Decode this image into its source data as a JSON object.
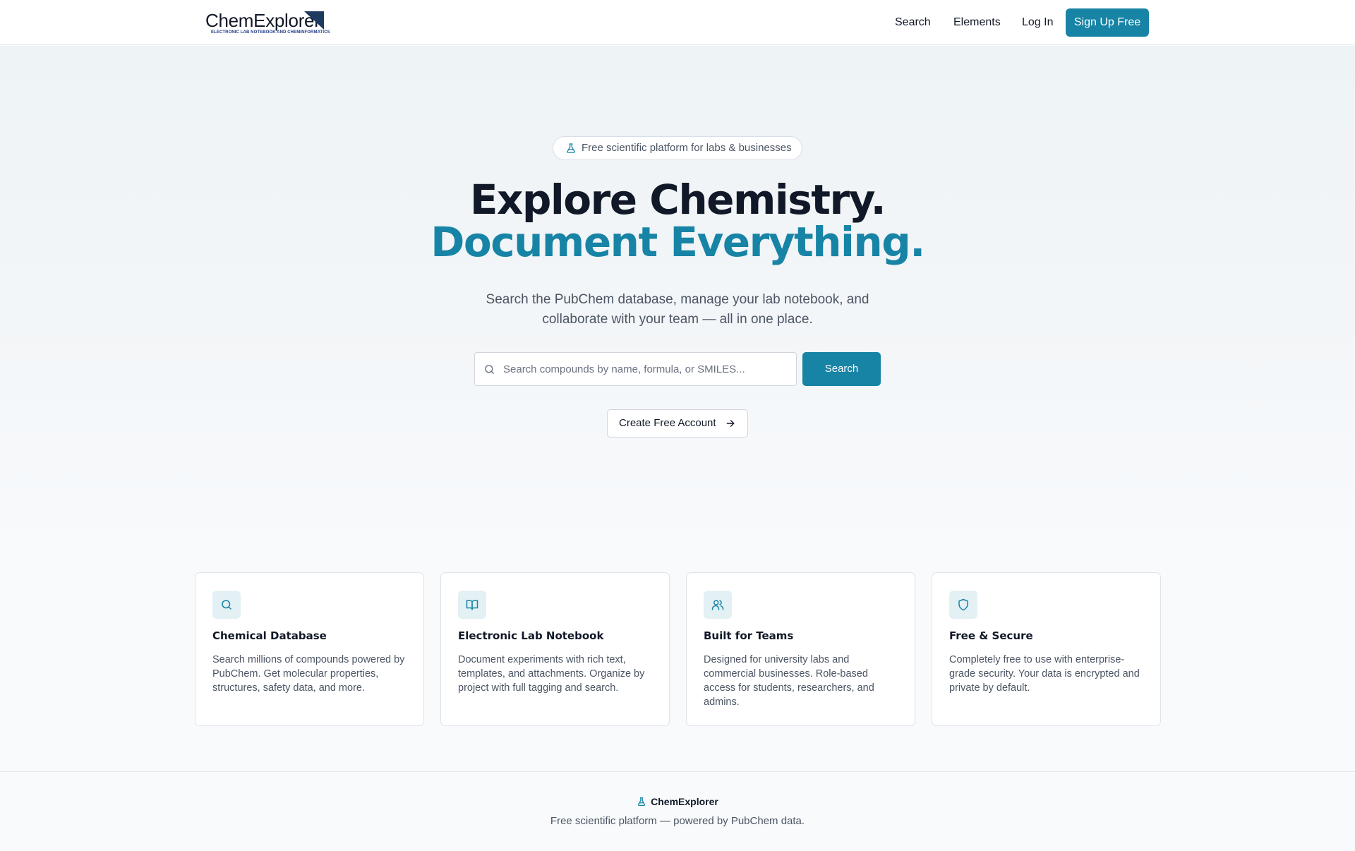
{
  "brand": {
    "name": "ChemExplorer",
    "tagline": "ELECTRONIC LAB NOTEBOOK AND CHEMINFORMATICS"
  },
  "nav": {
    "links": [
      "Search",
      "Elements",
      "Log In"
    ],
    "signup_label": "Sign Up Free"
  },
  "hero": {
    "badge_text": "Free scientific platform for labs & businesses",
    "title_line1": "Explore Chemistry.",
    "title_line2": "Document Everything.",
    "subtitle": "Search the PubChem database, manage your lab notebook, and collaborate with your team — all in one place.",
    "search_placeholder": "Search compounds by name, formula, or SMILES...",
    "search_button": "Search",
    "create_account": "Create Free Account"
  },
  "features": [
    {
      "icon": "search-icon",
      "title": "Chemical Database",
      "description": "Search millions of compounds powered by PubChem. Get molecular properties, structures, safety data, and more."
    },
    {
      "icon": "book-icon",
      "title": "Electronic Lab Notebook",
      "description": "Document experiments with rich text, templates, and attachments. Organize by project with full tagging and search."
    },
    {
      "icon": "users-icon",
      "title": "Built for Teams",
      "description": "Designed for university labs and commercial businesses. Role-based access for students, researchers, and admins."
    },
    {
      "icon": "shield-icon",
      "title": "Free & Secure",
      "description": "Completely free to use with enterprise-grade security. Your data is encrypted and private by default."
    }
  ],
  "footer": {
    "brand": "ChemExplorer",
    "text": "Free scientific platform — powered by PubChem data."
  },
  "colors": {
    "accent": "#1784a6",
    "text": "#111827",
    "muted": "#4b5563",
    "icon_bg": "#e3f0f4"
  }
}
